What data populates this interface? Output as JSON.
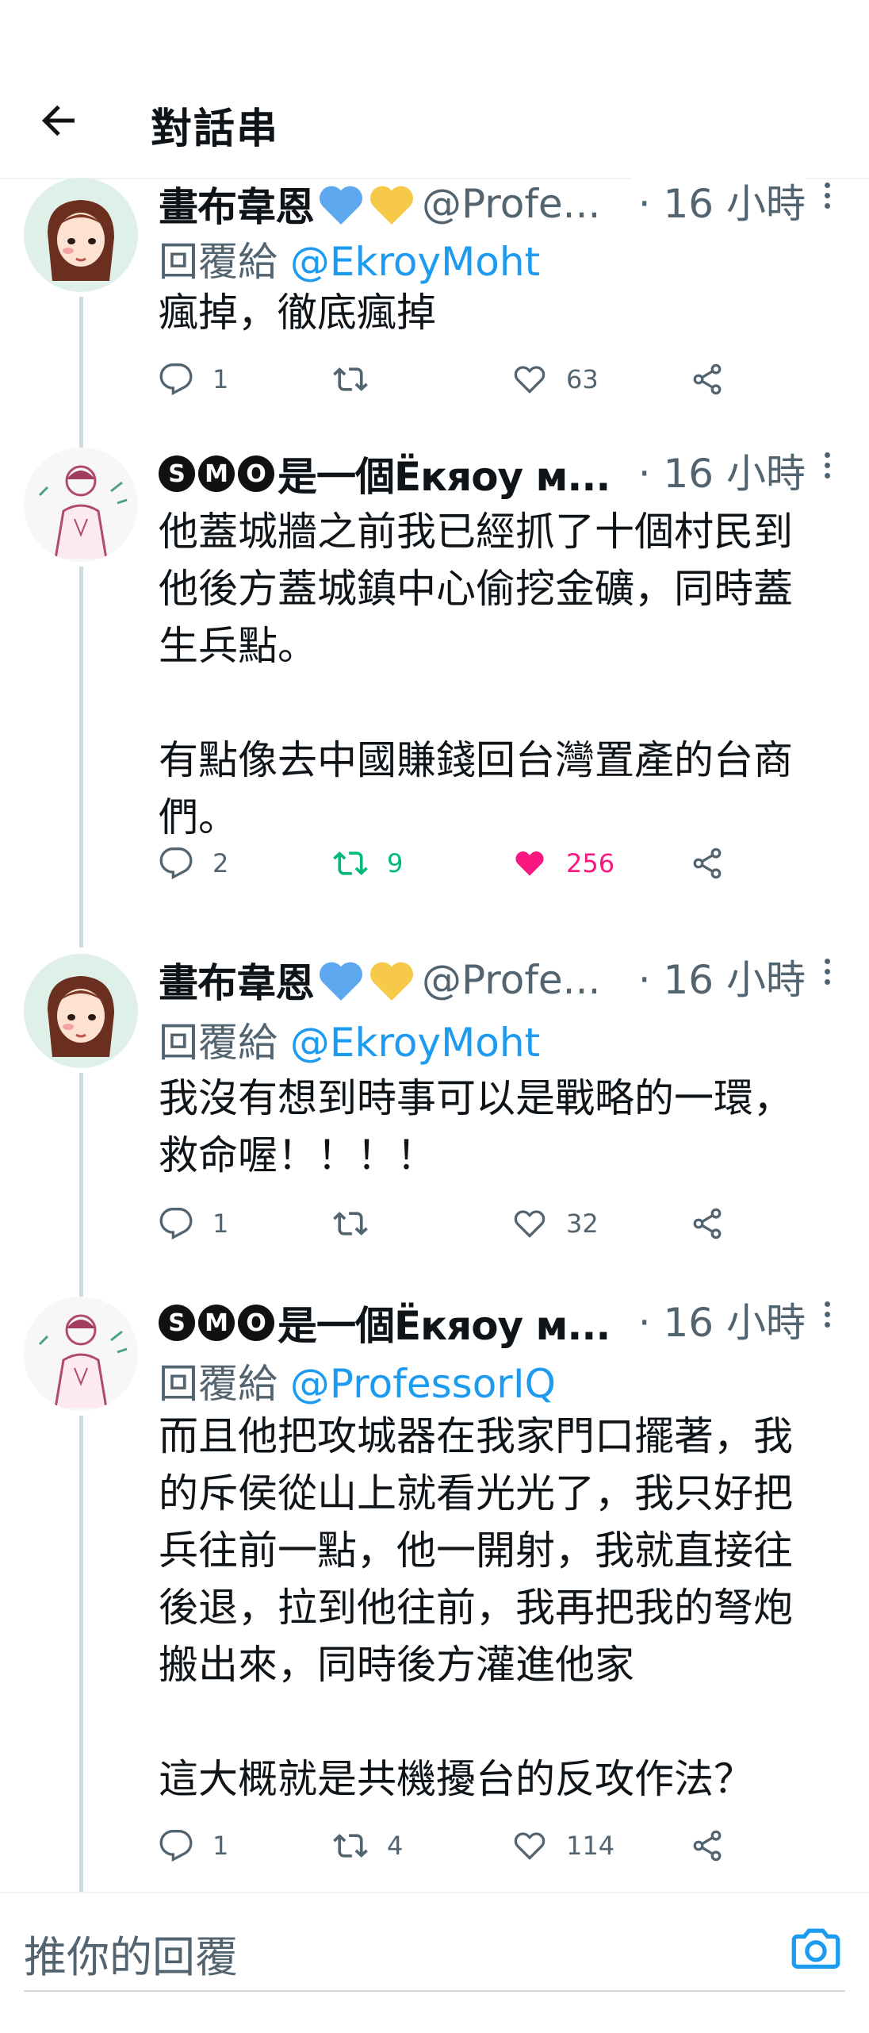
{
  "header": {
    "title": "對話串"
  },
  "tweets": [
    {
      "name": "畫布韋恩",
      "handle": "@Profe...",
      "time": "· 16 小時",
      "reply_prefix": "回覆給",
      "reply_to": "@EkroyMoht",
      "text": "瘋掉，徹底瘋掉",
      "replies": "1",
      "retweets": "",
      "likes": "63"
    },
    {
      "name_badges": [
        "S",
        "M",
        "O"
      ],
      "name": "是一個Ёкяоу м...",
      "time": "· 16 小時",
      "text": "他蓋城牆之前我已經抓了十個村民到\n他後方蓋城鎮中心偷挖金礦，同時蓋\n生兵點。\n\n有點像去中國賺錢回台灣置產的台商\n們。",
      "replies": "2",
      "retweets": "9",
      "likes": "256"
    },
    {
      "name": "畫布韋恩",
      "handle": "@Profe...",
      "time": "· 16 小時",
      "reply_prefix": "回覆給",
      "reply_to": "@EkroyMoht",
      "text": "我沒有想到時事可以是戰略的一環，\n救命喔！！！！",
      "replies": "1",
      "retweets": "",
      "likes": "32"
    },
    {
      "name_badges": [
        "S",
        "M",
        "O"
      ],
      "name": "是一個Ёкяоу м...",
      "time": "· 16 小時",
      "reply_prefix": "回覆給",
      "reply_to": "@ProfessorIQ",
      "text": "而且他把攻城器在我家門口擺著，我\n的斥侯從山上就看光光了，我只好把\n兵往前一點，他一開射，我就直接往\n後退，拉到他往前，我再把我的弩炮\n搬出來，同時後方灌進他家\n\n這大概就是共機擾台的反攻作法？",
      "replies": "1",
      "retweets": "4",
      "likes": "114"
    }
  ],
  "composer": {
    "placeholder": "推你的回覆"
  },
  "colors": {
    "link": "#1d9bf0",
    "retweet_active": "#00ba7c",
    "like_active": "#f91880",
    "muted": "#536471"
  },
  "icons": [
    "back-arrow-icon",
    "reply-icon",
    "retweet-icon",
    "like-icon",
    "share-icon",
    "more-icon",
    "camera-icon",
    "blue-heart-icon",
    "yellow-heart-icon"
  ]
}
